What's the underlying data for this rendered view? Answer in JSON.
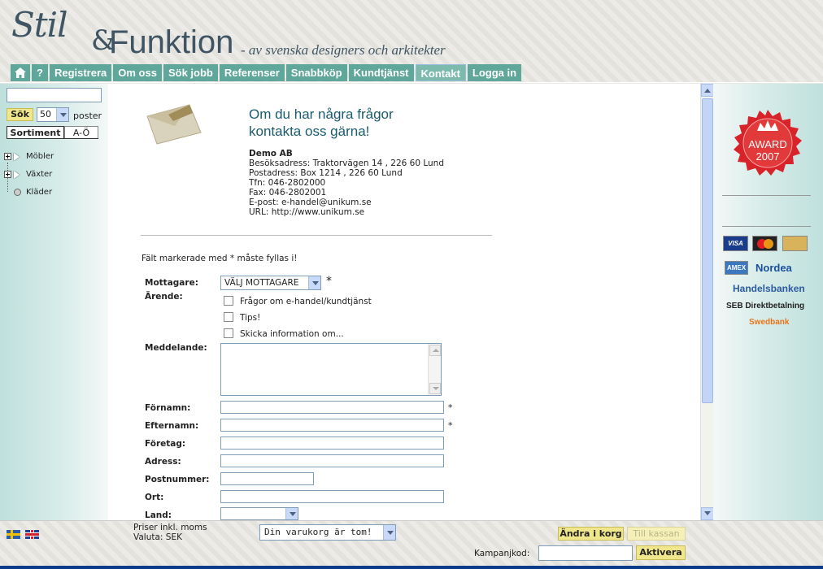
{
  "header": {
    "logo_stil": "Stil",
    "logo_amp": "&",
    "logo_funktion": "Funktion",
    "tagline": "- av svenska designers och arkitekter"
  },
  "nav": {
    "help": "?",
    "items": [
      "Registrera",
      "Om oss",
      "Sök jobb",
      "Referenser",
      "Snabbköp",
      "Kundtjänst",
      "Kontakt",
      "Logga in"
    ],
    "active": "Kontakt"
  },
  "sidebar": {
    "search_value": "",
    "search_button": "Sök",
    "count_selected": "50",
    "count_label": "poster",
    "tab_sortiment": "Sortiment",
    "tab_ao": "A-Ö",
    "tree": [
      "Möbler",
      "Växter",
      "Kläder"
    ]
  },
  "contact": {
    "headline1": "Om du har några frågor",
    "headline2": "kontakta oss gärna!",
    "company": "Demo AB",
    "visit": "Besöksadress: Traktorvägen 14 , 226 60 Lund",
    "post": "Postadress: Box 1214 , 226 60 Lund",
    "phone": "Tfn: 046-2802000",
    "fax": "Fax: 046-2802001",
    "email": "E-post: e-handel@unikum.se",
    "url": "URL: http://www.unikum.se"
  },
  "form": {
    "required_note": "Fält markerade med * måste fyllas i!",
    "star": "*",
    "mottagare_label": "Mottagare:",
    "mottagare_selected": "VÄLJ MOTTAGARE",
    "arende_label": "Ärende:",
    "arende_options": [
      "Frågor om e-handel/kundtjänst",
      "Tips!",
      "Skicka information om..."
    ],
    "meddelande_label": "Meddelande:",
    "fornamn_label": "Förnamn:",
    "efternamn_label": "Efternamn:",
    "foretag_label": "Företag:",
    "adress_label": "Adress:",
    "postnummer_label": "Postnummer:",
    "ort_label": "Ort:",
    "land_label": "Land:"
  },
  "right": {
    "award_text": "AWARD",
    "award_year": "2007",
    "cards": [
      "VISA",
      "MasterCard",
      "EUROCARD",
      "AMEX"
    ],
    "banks": [
      "Nordea",
      "Handelsbanken",
      "SEB Direktbetalning",
      "Swedbank"
    ]
  },
  "footer": {
    "prices_line1": "Priser inkl. moms",
    "prices_line2": "Valuta: SEK",
    "cart_selected": "Din varukorg är tom!",
    "andra_button": "Ändra i korg",
    "kassan_button": "Till kassan",
    "kampanj_label": "Kampanjkod:",
    "kampanj_value": "",
    "aktivera_button": "Aktivera"
  },
  "colors": {
    "nav_bg": "#5ea79a",
    "headline": "#1b5b6f",
    "button_yellow": "#f0e68c",
    "logo": "#3f5563"
  }
}
